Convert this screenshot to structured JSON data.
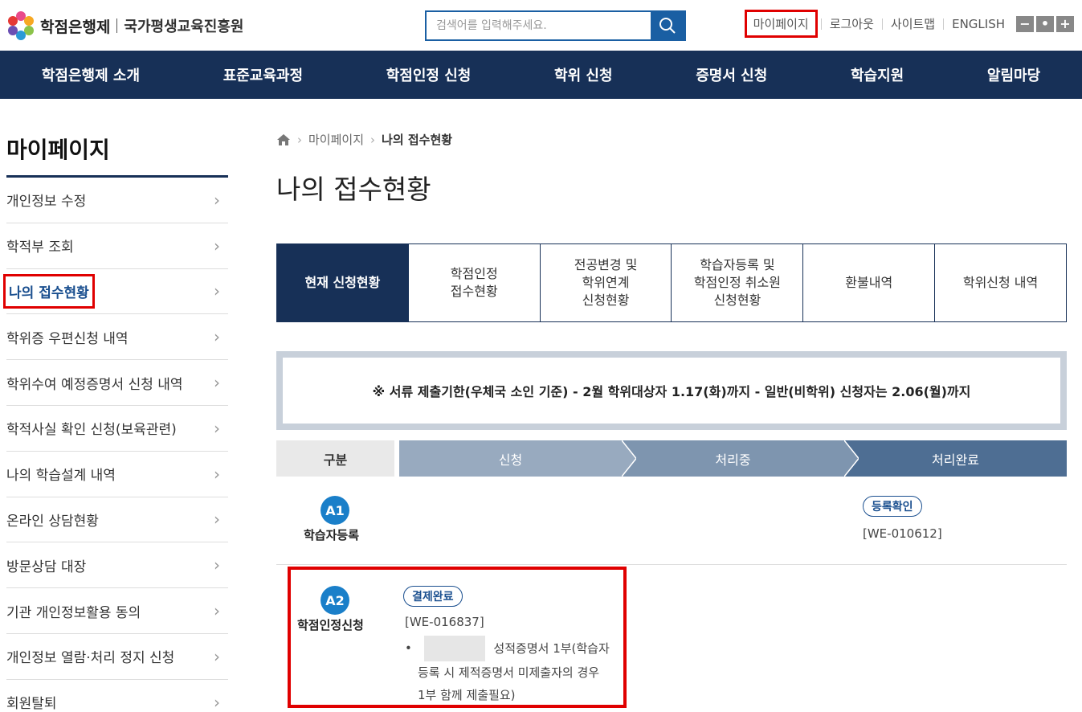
{
  "header": {
    "logo_text": "학점은행제",
    "org_name": "국가평생교육진흥원",
    "search_placeholder": "검색어를 입력해주세요.",
    "util_links": [
      "마이페이지",
      "로그아웃",
      "사이트맵",
      "ENGLISH"
    ],
    "zoom_buttons": [
      "−",
      "•",
      "+"
    ]
  },
  "gnb": [
    "학점은행제 소개",
    "표준교육과정",
    "학점인정 신청",
    "학위 신청",
    "증명서 신청",
    "학습지원",
    "알림마당"
  ],
  "sidebar": {
    "title": "마이페이지",
    "items": [
      "개인정보 수정",
      "학적부 조회",
      "나의 접수현황",
      "학위증 우편신청 내역",
      "학위수여 예정증명서 신청 내역",
      "학적사실 확인 신청(보육관련)",
      "나의 학습설계 내역",
      "온라인 상담현황",
      "방문상담 대장",
      "기관 개인정보활용 동의",
      "개인정보 열람·처리 정지 신청",
      "회원탈퇴"
    ]
  },
  "breadcrumb": {
    "level1": "마이페이지",
    "current": "나의 접수현황"
  },
  "page_title": "나의 접수현황",
  "tabs": [
    "현재 신청현황",
    "학점인정\n접수현황",
    "전공변경 및\n학위연계\n신청현황",
    "학습자등록 및\n학점인정 취소원\n신청현황",
    "환불내역",
    "학위신청 내역"
  ],
  "notice": "※ 서류 제출기한(우체국 소인 기준) - 2월 학위대상자 1.17(화)까지 - 일반(비학위) 신청자는 2.06(월)까지",
  "steps": {
    "label": "구분",
    "s1": "신청",
    "s2": "처리중",
    "s3": "처리완료"
  },
  "rows": {
    "a1": {
      "badge": "A1",
      "name": "학습자등록",
      "status": "등록확인",
      "code": "[WE-010612]"
    },
    "a2": {
      "badge": "A2",
      "name": "학점인정신청",
      "status": "결제완료",
      "code": "[WE-016837]",
      "bullet": "•",
      "detail_line1": "성적증명서 1부(학습자",
      "detail_line2": "등록 시 제적증명서 미제출자의 경우",
      "detail_line3": "1부 함께 제출필요)"
    }
  }
}
